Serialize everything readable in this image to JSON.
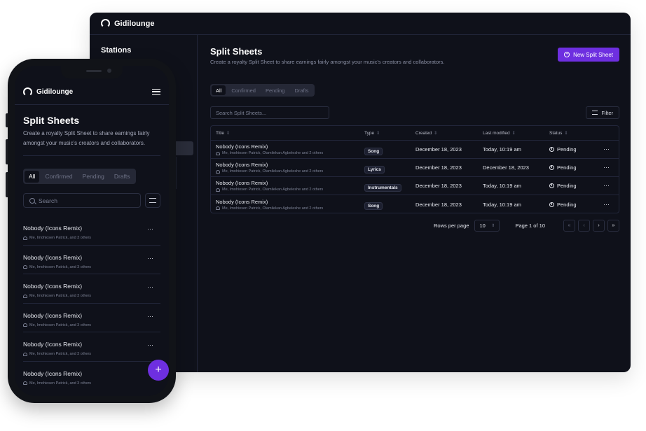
{
  "brand": "Gidilounge",
  "desktop": {
    "sidebar": {
      "stations": "Stations"
    },
    "title": "Split Sheets",
    "subtitle": "Create a royalty Split Sheet to share earnings fairly amongst your music's creators and collaborators.",
    "new_button": "New Split Sheet",
    "tabs": [
      "All",
      "Confirmed",
      "Pending",
      "Drafts"
    ],
    "search_placeholder": "Search Split Sheets...",
    "filter_label": "Filter",
    "columns": [
      "Title",
      "Type",
      "Created",
      "Last modified",
      "Status"
    ],
    "rows": [
      {
        "title": "Nobody (Icons Remix)",
        "people": "Me, Imohiosen Patrick, Olamilekan Agbeleshe and 2 others",
        "type": "Song",
        "created": "December 18, 2023",
        "modified": "Today, 10:19 am",
        "status": "Pending"
      },
      {
        "title": "Nobody (Icons Remix)",
        "people": "Me, Imohiosen Patrick, Olamilekan Agbeleshe and 2 others",
        "type": "Lyrics",
        "created": "December 18, 2023",
        "modified": "December 18, 2023",
        "status": "Pending"
      },
      {
        "title": "Nobody (Icons Remix)",
        "people": "Me, Imohiosen Patrick, Olamilekan Agbeleshe and 2 others",
        "type": "Instrumentals",
        "created": "December 18, 2023",
        "modified": "Today, 10:19 am",
        "status": "Pending"
      },
      {
        "title": "Nobody (Icons Remix)",
        "people": "Me, Imohiosen Patrick, Olamilekan Agbeleshe and 2 others",
        "type": "Song",
        "created": "December 18, 2023",
        "modified": "Today, 10:19 am",
        "status": "Pending"
      }
    ],
    "pager": {
      "rows_per_page_label": "Rows per page",
      "rows_per_page": "10",
      "page_info": "Page 1 of 10",
      "first": "«",
      "prev": "‹",
      "next": "›",
      "last": "»"
    }
  },
  "phone": {
    "title": "Split Sheets",
    "subtitle": "Create a royalty Split Sheet to share earnings fairly amongst your music's creators and collaborators.",
    "tabs": [
      "All",
      "Confirmed",
      "Pending",
      "Drafts"
    ],
    "search_placeholder": "Search",
    "items": [
      {
        "title": "Nobody (Icons Remix)",
        "people": "Me, Imohiosen Patrick, and 3 others"
      },
      {
        "title": "Nobody (Icons Remix)",
        "people": "Me, Imohiosen Patrick, and 3 others"
      },
      {
        "title": "Nobody (Icons Remix)",
        "people": "Me, Imohiosen Patrick, and 3 others"
      },
      {
        "title": "Nobody (Icons Remix)",
        "people": "Me, Imohiosen Patrick, and 3 others"
      },
      {
        "title": "Nobody (Icons Remix)",
        "people": "Me, Imohiosen Patrick, and 3 others"
      },
      {
        "title": "Nobody (Icons Remix)",
        "people": "Me, Imohiosen Patrick, and 3 others"
      }
    ],
    "fab": "+"
  },
  "colors": {
    "accent": "#6e2fe0",
    "background": "#0f111a",
    "border": "#22263a"
  },
  "icons": {
    "more": "⋯",
    "sort": "⇕",
    "add": "+"
  }
}
